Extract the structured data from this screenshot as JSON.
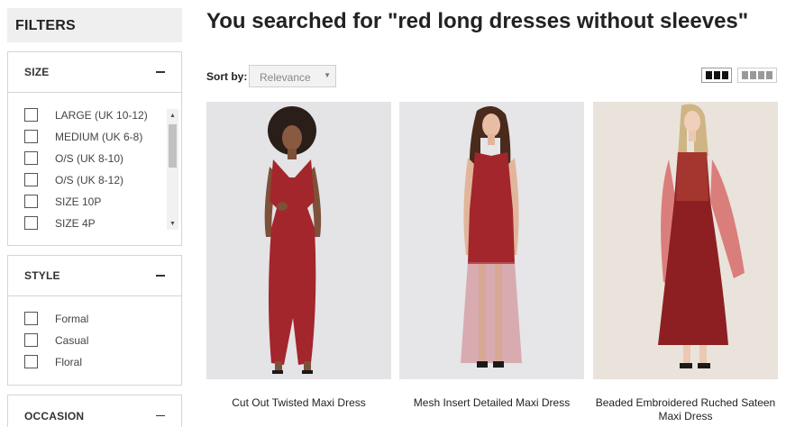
{
  "sidebar": {
    "filters_title": "FILTERS",
    "size": {
      "title": "SIZE",
      "toggle_icon": "minus-icon",
      "options": [
        "LARGE (UK 10-12)",
        "MEDIUM (UK 6-8)",
        "O/S (UK 8-10)",
        "O/S (UK 8-12)",
        "SIZE 10P",
        "SIZE 4P"
      ]
    },
    "style": {
      "title": "STYLE",
      "toggle_icon": "minus-icon",
      "options": [
        "Formal",
        "Casual",
        "Floral"
      ]
    },
    "occasion": {
      "title": "OCCASION",
      "toggle_icon": "minus-icon"
    }
  },
  "main": {
    "title": "You searched for \"red long dresses without sleeves\"",
    "sort_label": "Sort by:",
    "sort_value": "Relevance",
    "view_modes": [
      "grid-3-icon",
      "grid-4-icon"
    ],
    "products": [
      {
        "name": "Cut Out Twisted Maxi Dress",
        "image": "dress-photo"
      },
      {
        "name": "Mesh Insert Detailed Maxi Dress",
        "image": "dress-photo"
      },
      {
        "name": "Beaded Embroidered Ruched Sateen Maxi Dress",
        "image": "dress-photo"
      }
    ]
  },
  "colors": {
    "dress_red": "#a3262c",
    "photo_bg": "#e7e6e8"
  }
}
